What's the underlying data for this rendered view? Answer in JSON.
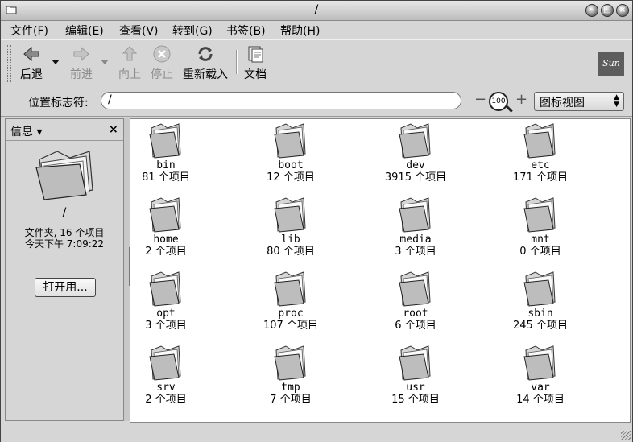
{
  "window": {
    "title": "/"
  },
  "menubar": [
    "文件(F)",
    "编辑(E)",
    "查看(V)",
    "转到(G)",
    "书签(B)",
    "帮助(H)"
  ],
  "toolbar": {
    "back": "后退",
    "forward": "前进",
    "up": "向上",
    "stop": "停止",
    "reload": "重新载入",
    "docs": "文档",
    "logo": "Sun"
  },
  "location": {
    "label": "位置标志符:",
    "value": "/",
    "zoom": "100",
    "view_mode": "图标视图"
  },
  "sidebar": {
    "title": "信息",
    "folder_name": "/",
    "info_line1": "文件夹, 16 个项目",
    "info_line2": "今天下午 7:09:22",
    "open_with": "打开用..."
  },
  "items": [
    {
      "name": "bin",
      "count": "81 个项目"
    },
    {
      "name": "boot",
      "count": "12 个项目"
    },
    {
      "name": "dev",
      "count": "3915 个项目"
    },
    {
      "name": "etc",
      "count": "171 个项目"
    },
    {
      "name": "home",
      "count": "2 个项目"
    },
    {
      "name": "lib",
      "count": "80 个项目"
    },
    {
      "name": "media",
      "count": "3 个项目"
    },
    {
      "name": "mnt",
      "count": "0 个项目"
    },
    {
      "name": "opt",
      "count": "3 个项目"
    },
    {
      "name": "proc",
      "count": "107 个项目"
    },
    {
      "name": "root",
      "count": "6 个项目"
    },
    {
      "name": "sbin",
      "count": "245 个项目"
    },
    {
      "name": "srv",
      "count": "2 个项目"
    },
    {
      "name": "tmp",
      "count": "7 个项目"
    },
    {
      "name": "usr",
      "count": "15 个项目"
    },
    {
      "name": "var",
      "count": "14 个项目"
    }
  ]
}
